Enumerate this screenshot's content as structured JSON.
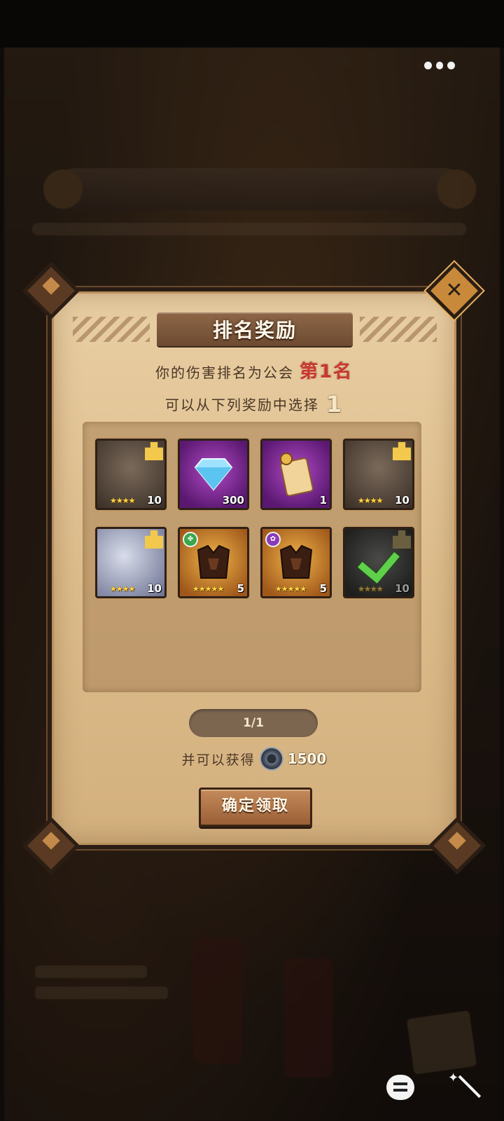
{
  "dialog": {
    "title": "排名奖励",
    "rank_prefix": "你的伤害排名为公会",
    "rank_value": "第1名",
    "choose_prefix": "可以从下列奖励中选择",
    "choose_count": "1",
    "page_indicator": "1/1",
    "extra_prefix": "并可以获得",
    "extra_amount": "1500",
    "confirm_label": "确定领取",
    "close_icon": "close-icon"
  },
  "rewards": [
    {
      "name": "hero-shard-cowboy",
      "count": "10",
      "stars": "★★★★",
      "art": "hero",
      "piece": true
    },
    {
      "name": "diamond",
      "count": "300",
      "stars": "",
      "art": "purple"
    },
    {
      "name": "scroll",
      "count": "1",
      "stars": "",
      "art": "purple"
    },
    {
      "name": "hero-shard-knight",
      "count": "10",
      "stars": "★★★★",
      "art": "hero",
      "piece": true
    },
    {
      "name": "hero-shard-mage",
      "count": "10",
      "stars": "★★★★",
      "art": "hero",
      "piece": true
    },
    {
      "name": "armor-green",
      "count": "5",
      "stars": "★★★★★",
      "art": "gold",
      "badge_color": "#3aa84a"
    },
    {
      "name": "armor-purple",
      "count": "5",
      "stars": "★★★★★",
      "art": "gold",
      "badge_color": "#8a3ab8"
    },
    {
      "name": "selected-shard",
      "count": "10",
      "stars": "★★★★",
      "art": "dark",
      "selected": true
    }
  ],
  "colors": {
    "rank_red": "#c8382c",
    "panel_parchment": "#e9cfa4",
    "frame_dark": "#2a1d14"
  }
}
